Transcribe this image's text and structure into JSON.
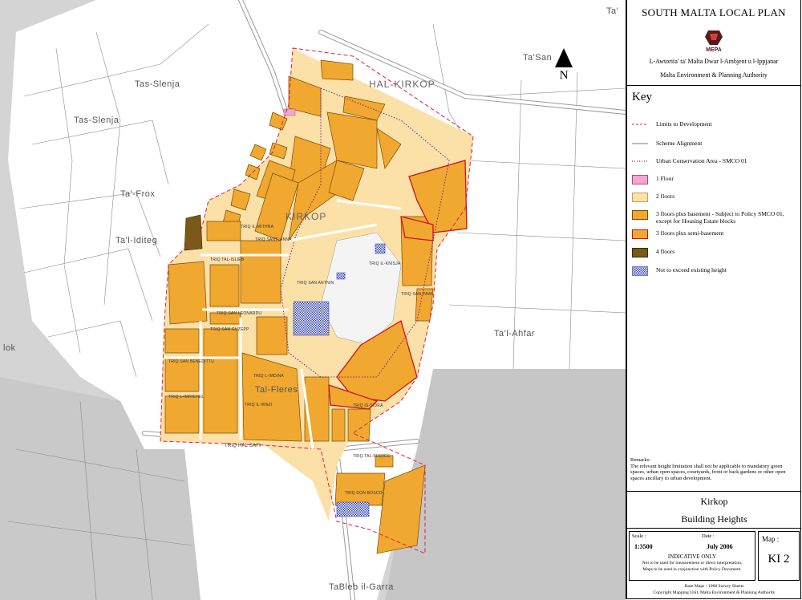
{
  "header": {
    "title": "SOUTH MALTA LOCAL PLAN",
    "logo_text": "MEPA",
    "authority_mt": "L-Awtorita' ta' Malta Dwar l-Ambjent u l-Ippjanar",
    "authority_en": "Malta Environment & Planning Authority"
  },
  "north": {
    "label": "N"
  },
  "key": {
    "title": "Key",
    "items": [
      {
        "label": "Limits to Development",
        "symbol": "dash-red",
        "color": "#e0203a"
      },
      {
        "label": "Scheme Alignment",
        "symbol": "line-blue",
        "color": "#7070d8"
      },
      {
        "label": "Urban Conservation Area - SMCO 01",
        "symbol": "dot-purple",
        "color": "#8a1a8a"
      },
      {
        "label": "1 Floor",
        "symbol": "fill",
        "color": "#f4a6d0"
      },
      {
        "label": "2 floors",
        "symbol": "fill",
        "color": "#fbe0a8"
      },
      {
        "label": "3 floors plus basement - Subject to Policy SMCO 01, except for Housing Estate blocks",
        "symbol": "fill",
        "color": "#f0a830"
      },
      {
        "label": "3 floors plus semi-basement",
        "symbol": "fill-red",
        "color": "#f0a830"
      },
      {
        "label": "4 floors",
        "symbol": "fill",
        "color": "#7a5a18"
      },
      {
        "label": "Not to exceed existing height",
        "symbol": "hatch",
        "color": "#3040b0"
      }
    ]
  },
  "remarks": {
    "title": "Remarks:",
    "text": "The relevant height limitation shall not be applicable to mandatory green spaces, urban open spaces, courtyards, front or back gardens or other open spaces ancillary to urban development."
  },
  "place": {
    "name": "Kirkop",
    "map_title": "Building Heights"
  },
  "scale": {
    "scale_label": "Scale :",
    "scale_value": "1:3500",
    "date_label": "Date :",
    "date_value": "July 2006",
    "map_label": "Map :",
    "map_value": "KI 2",
    "indicative": "INDICATIVE ONLY",
    "note1": "Not to be used for measurement or direct interpretation.",
    "note2": "Maps to be used in conjunction with Policy Document."
  },
  "footer": {
    "line1": "Base Maps - 1988 Survey Sheets",
    "line2": "Copyright Mapping Unit, Malta Environment & Planning Authority"
  },
  "map_labels": {
    "hal_kirkop": "HAL-KIRKOP",
    "kirkop": "KIRKOP",
    "tas_slenja_1": "Tas-Slenja",
    "tas_slenja_2": "Tas-Slenja",
    "ta_frox": "Ta'-Frox",
    "ta_l_iditeg": "Ta'l-Iditeg",
    "ta_l_ahfar": "Ta'l-Ahfar",
    "ta_san_nicola": "Ta'San",
    "ta_corner": "Ta'",
    "lok": "lok",
    "tal_fleres": "Tal-Fleres",
    "ta_bleb": "TaBleb il-Garra",
    "hal_safi": "TRIQ HAL SAFI"
  },
  "street_labels": [
    "TRIQ TAL-ISLIEB",
    "TRIQ SAN LEONARDU",
    "TRIQ SAN BENEDITTU",
    "TRIQ SANT' ANNA",
    "TRIQ SAN GUZEPP",
    "TRIQ L-IMRIEHEL",
    "TRIQ IL-WIED",
    "TRIQ IS-SIDRA",
    "TRIQ TAL-FLERES",
    "TRIQ SAN PAWL",
    "TRIQ SAN ANTNIN",
    "TRIQ L-IMDINA",
    "TRIQ IL-MITHNA",
    "TRIQ DON BOSCO",
    "TRIQ IL-KNISJA"
  ]
}
